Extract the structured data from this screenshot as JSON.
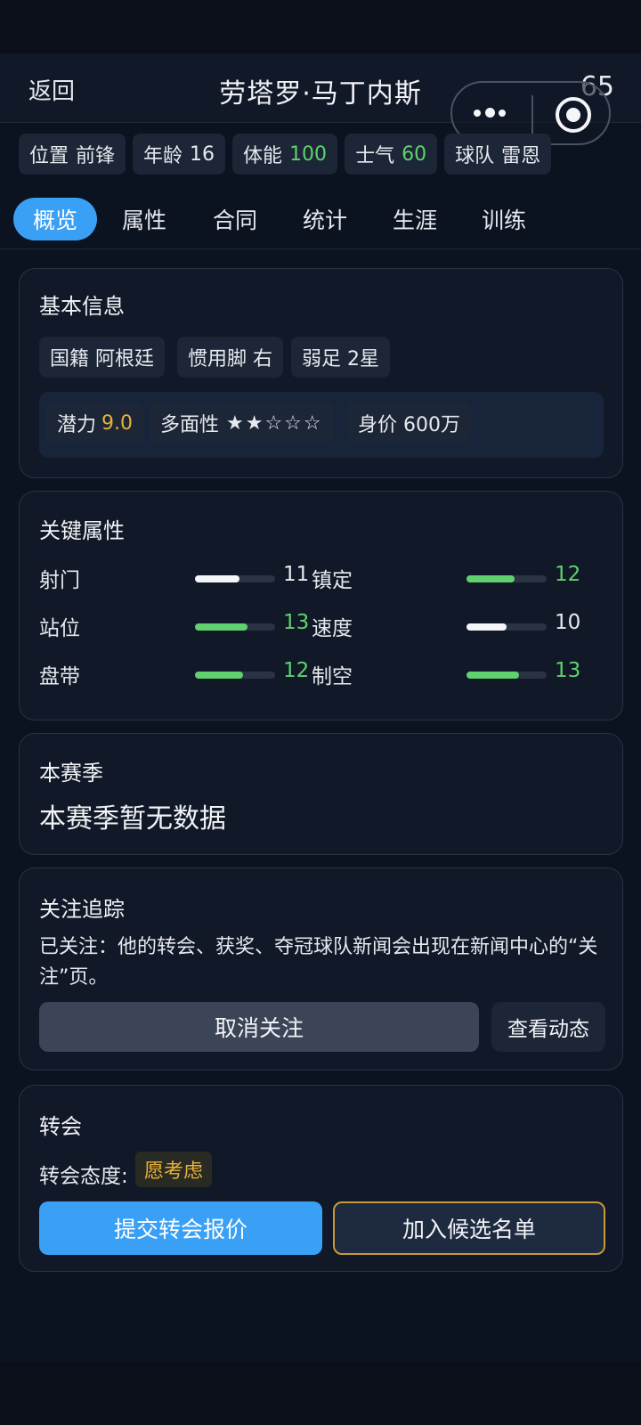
{
  "header": {
    "back_label": "返回",
    "title": "劳塔罗·马丁内斯",
    "rating": "65"
  },
  "chips": [
    {
      "label": "位置",
      "value": "前锋"
    },
    {
      "label": "年龄",
      "value": "16"
    },
    {
      "label": "体能",
      "value": "100"
    },
    {
      "label": "士气",
      "value": "60"
    },
    {
      "label": "球队",
      "value": "雷恩"
    }
  ],
  "tabs": [
    "概览",
    "属性",
    "合同",
    "统计",
    "生涯",
    "训练"
  ],
  "basic_info": {
    "title": "基本信息",
    "nationality": "国籍 阿根廷",
    "preferred_foot": "惯用脚 右",
    "weak_foot": "弱足 2星",
    "potential_label": "潜力",
    "potential_value": "9.0",
    "versatility_label": "多面性",
    "versatility_stars": "★★☆☆☆",
    "value": "身价 600万"
  },
  "key_attributes": {
    "title": "关键属性",
    "items": [
      {
        "name": "射门",
        "value": "11",
        "level": 0.55
      },
      {
        "name": "镇定",
        "value": "12",
        "level": 0.6
      },
      {
        "name": "站位",
        "value": "13",
        "level": 0.65
      },
      {
        "name": "速度",
        "value": "10",
        "level": 0.5
      },
      {
        "name": "盘带",
        "value": "12",
        "level": 0.6
      },
      {
        "name": "制空",
        "value": "13",
        "level": 0.65
      }
    ]
  },
  "season": {
    "title": "本赛季",
    "empty_text": "本赛季暂无数据"
  },
  "follow": {
    "title": "关注追踪",
    "description": "已关注：他的转会、获奖、夺冠球队新闻会出现在新闻中心的“关注”页。",
    "unfollow_label": "取消关注",
    "view_label": "查看动态"
  },
  "transfer": {
    "title": "转会",
    "attitude_label": "转会态度:",
    "attitude_value": "愿考虑",
    "offer_label": "提交转会报价",
    "shortlist_label": "加入候选名单"
  },
  "colors": {
    "accent": "#3aa0f5",
    "good": "#5fd16e",
    "gold": "#e7b23a",
    "bar_white": "#f4f6f9"
  }
}
